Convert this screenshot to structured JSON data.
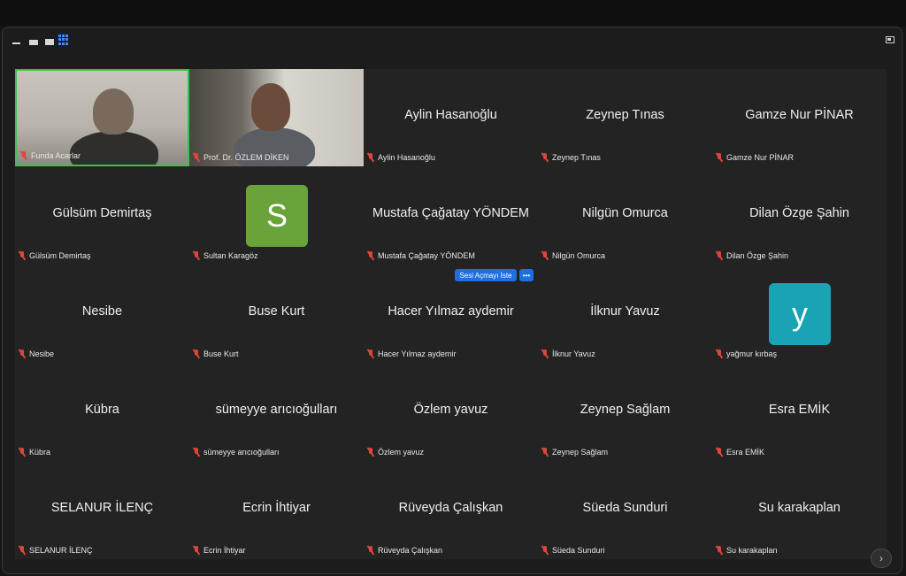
{
  "colors": {
    "accent_blue": "#1e6fe0",
    "mute_red": "#e0453a",
    "active_speaker_green": "#3cbf4c",
    "avatar_green": "#6aa33a",
    "avatar_teal": "#1aa3b4"
  },
  "toolbar": {
    "icons": [
      "speaker-view-icon",
      "side-by-side-icon",
      "thumbnail-icon",
      "gallery-view-icon",
      "fullscreen-icon"
    ]
  },
  "participants": [
    {
      "name": "Funda Acarlar",
      "display": "",
      "video": true
    },
    {
      "name": "Prof. Dr. ÖZLEM DİKEN",
      "display": "",
      "video": true
    },
    {
      "name": "Aylin Hasanoğlu",
      "display": "Aylin Hasanoğlu"
    },
    {
      "name": "Zeynep Tınas",
      "display": "Zeynep Tınas"
    },
    {
      "name": "Gamze Nur PİNAR",
      "display": "Gamze Nur PİNAR"
    },
    {
      "name": "Gülsüm Demirtaş",
      "display": "Gülsüm Demirtaş"
    },
    {
      "name": "Sultan Karagöz",
      "display": "",
      "avatar": "S"
    },
    {
      "name": "Mustafa Çağatay YÖNDEM",
      "display": "Mustafa Çağatay YÖNDEM"
    },
    {
      "name": "Nilgün Omurca",
      "display": "Nilgün Omurca"
    },
    {
      "name": "Dilan Özge Şahin",
      "display": "Dilan Özge Şahin"
    },
    {
      "name": "Nesibe",
      "display": "Nesibe"
    },
    {
      "name": "Buse Kurt",
      "display": "Buse Kurt"
    },
    {
      "name": "Hacer Yılmaz aydemir",
      "display": "Hacer Yılmaz aydemir"
    },
    {
      "name": "İlknur Yavuz",
      "display": "İlknur Yavuz"
    },
    {
      "name": "yağmur kırbaş",
      "display": "",
      "avatar": "y"
    },
    {
      "name": "Kübra",
      "display": "Kübra"
    },
    {
      "name": "sümeyye arıcıoğulları",
      "display": "sümeyye arıcıoğulları"
    },
    {
      "name": "Özlem yavuz",
      "display": "Özlem yavuz"
    },
    {
      "name": "Zeynep Sağlam",
      "display": "Zeynep Sağlam"
    },
    {
      "name": "Esra EMİK",
      "display": "Esra EMİK"
    },
    {
      "name": "SELANUR İLENÇ",
      "display": "SELANUR İLENÇ"
    },
    {
      "name": "Ecrin İhtiyar",
      "display": "Ecrin İhtiyar"
    },
    {
      "name": "Rüveyda Çalışkan",
      "display": "Rüveyda Çalışkan"
    },
    {
      "name": "Süeda Sunduri",
      "display": "Süeda Sunduri"
    },
    {
      "name": "Su karakaplan",
      "display": "Su karakaplan"
    }
  ],
  "popup": {
    "ask_unmute_label": "Sesi Açmayı İste",
    "more_label": "•••"
  },
  "pagination": {
    "next_label": "›"
  }
}
